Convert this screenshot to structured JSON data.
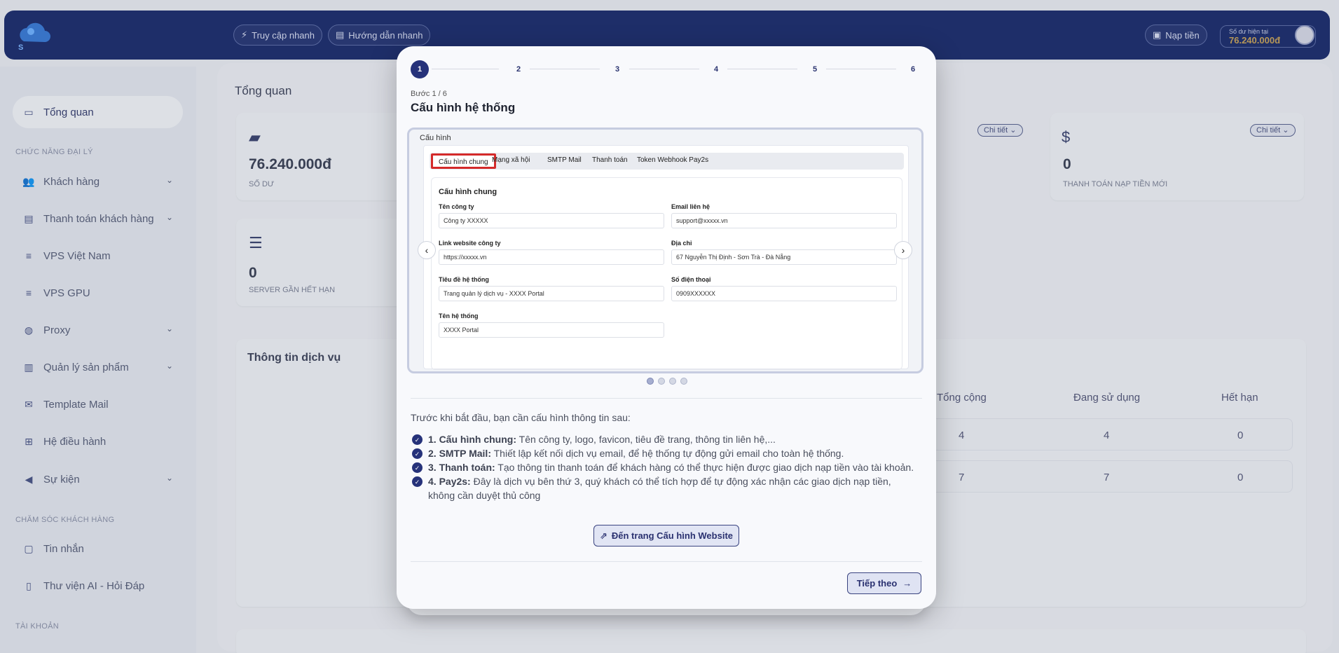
{
  "header": {
    "logo_text": "S",
    "quick_access": "Truy cập nhanh",
    "quick_guide": "Hướng dẫn nhanh",
    "topup": "Nạp tiền",
    "balance_label": "Số dư hiện tại",
    "balance_value": "76.240.000đ"
  },
  "sidebar": {
    "items": [
      {
        "label": "Tổng quan",
        "icon": "dashboard-icon"
      },
      {
        "label": "Khách hàng",
        "icon": "users-icon"
      },
      {
        "label": "Thanh toán khách hàng",
        "icon": "payment-card-icon"
      },
      {
        "label": "VPS Việt Nam",
        "icon": "server-icon"
      },
      {
        "label": "VPS GPU",
        "icon": "server-icon"
      },
      {
        "label": "Proxy",
        "icon": "globe-icon"
      },
      {
        "label": "Quản lý sản phẩm",
        "icon": "database-icon"
      },
      {
        "label": "Template Mail",
        "icon": "mail-icon"
      },
      {
        "label": "Hệ điều hành",
        "icon": "windows-icon"
      },
      {
        "label": "Sự kiện",
        "icon": "megaphone-icon"
      },
      {
        "label": "Tin nhắn",
        "icon": "chat-icon"
      },
      {
        "label": "Thư viện AI - Hỏi Đáp",
        "icon": "document-icon"
      }
    ],
    "sections": [
      "CHỨC NĂNG ĐẠI LÝ",
      "CHĂM SÓC KHÁCH HÀNG",
      "TÀI KHOẢN"
    ]
  },
  "dashboard": {
    "title": "Tổng quan",
    "balance_value": "76.240.000đ",
    "balance_label": "SỐ DƯ",
    "server_value": "0",
    "server_label": "SERVER GẦN HẾT HẠN",
    "topup_value": "0",
    "topup_label": "THANH TOÁN NẠP TIỀN MỚI",
    "detail": "Chi tiết",
    "service_info": "Thông tin dịch vụ",
    "table": {
      "headers": [
        "Tổng cộng",
        "Đang sử dụng",
        "Hết hạn"
      ],
      "rows": [
        [
          "4",
          "4",
          "0"
        ],
        [
          "7",
          "7",
          "0"
        ]
      ]
    }
  },
  "modal": {
    "steps": [
      "1",
      "2",
      "3",
      "4",
      "5",
      "6"
    ],
    "active_step": 1,
    "step_sub": "Bước 1 / 6",
    "title": "Cấu hình hệ thống",
    "preview": {
      "label": "Cấu hình",
      "tabs": [
        "Cấu hình chung",
        "Mạng xã hội",
        "SMTP Mail",
        "Thanh toán",
        "Token Webhook Pay2s"
      ],
      "form_title": "Cấu hình chung",
      "fields": {
        "company_label": "Tên công ty",
        "company_value": "Công ty XXXXX",
        "email_label": "Email liên hệ",
        "email_value": "support@xxxxx.vn",
        "website_label": "Link website công ty",
        "website_value": "https://xxxxx.vn",
        "address_label": "Địa chỉ",
        "address_value": "67 Nguyễn Thị Định - Sơn Trà - Đà Nẵng",
        "system_title_label": "Tiêu đề hệ thống",
        "system_title_value": "Trang quản lý dịch vụ - XXXX Portal",
        "phone_label": "Số điện thoại",
        "phone_value": "0909XXXXXX",
        "system_name_label": "Tên hệ thống",
        "system_name_value": "XXXX Portal"
      }
    },
    "intro": "Trước khi bắt đầu, bạn cần cấu hình thông tin sau:",
    "checklist": [
      {
        "title": "1. Cấu hình chung:",
        "text": " Tên công ty, logo, favicon, tiêu đề trang, thông tin liên hệ,..."
      },
      {
        "title": "2. SMTP Mail:",
        "text": " Thiết lập kết nối dịch vụ email, để hệ thống tự động gửi email cho toàn hệ thống."
      },
      {
        "title": "3. Thanh toán:",
        "text": " Tạo thông tin thanh toán để khách hàng có thể thực hiện được giao dịch nạp tiền vào tài khoản."
      },
      {
        "title": "4. Pay2s:",
        "text": " Đây là dịch vụ bên thứ 3, quý khách có thể tích hợp để tự động xác nhận các giao dịch nạp tiền, không cần duyệt thủ công"
      }
    ],
    "goto_button": "Đến trang Cấu hình Website",
    "next_button": "Tiếp theo"
  }
}
